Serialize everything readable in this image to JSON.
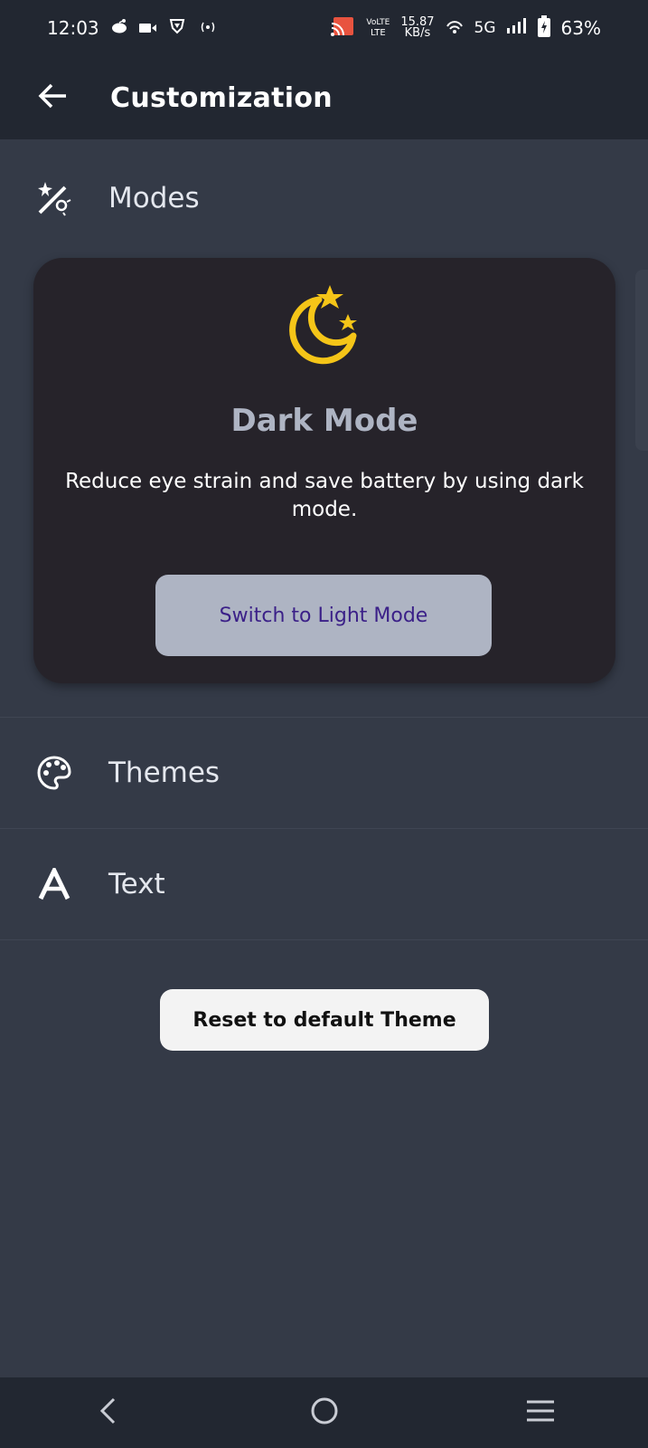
{
  "status_bar": {
    "time": "12:03",
    "network_top": "VoLTE",
    "network_bottom": "LTE",
    "speed_value": "15.87",
    "speed_unit": "KB/s",
    "network_type": "5G",
    "battery": "63%",
    "icons": [
      "reddit-icon",
      "video-icon",
      "vpn-shield-icon",
      "hotspot-icon",
      "cast-icon",
      "wifi-icon",
      "signal-icon",
      "battery-icon"
    ]
  },
  "app_bar": {
    "title": "Customization",
    "back_icon": "arrow-left-icon"
  },
  "sections": {
    "modes": {
      "label": "Modes",
      "icon": "magic-wand-icon"
    },
    "themes": {
      "label": "Themes",
      "icon": "palette-icon"
    },
    "text": {
      "label": "Text",
      "icon": "letter-a-icon"
    }
  },
  "dark_mode_card": {
    "icon": "moon-stars-icon",
    "title": "Dark Mode",
    "description": "Reduce eye strain and save battery by using dark mode.",
    "button_label": "Switch to Light Mode",
    "icon_color": "#f5c518"
  },
  "reset_button": {
    "label": "Reset to default Theme"
  },
  "nav_bar": {
    "back_icon": "nav-back-icon",
    "home_icon": "nav-home-icon",
    "recents_icon": "nav-menu-icon"
  },
  "colors": {
    "background": "#343a47",
    "app_bar": "#222731",
    "card": "#26232a",
    "button_primary": "#aeb4c3",
    "button_text": "#3b2088",
    "accent_yellow": "#f5c518"
  }
}
